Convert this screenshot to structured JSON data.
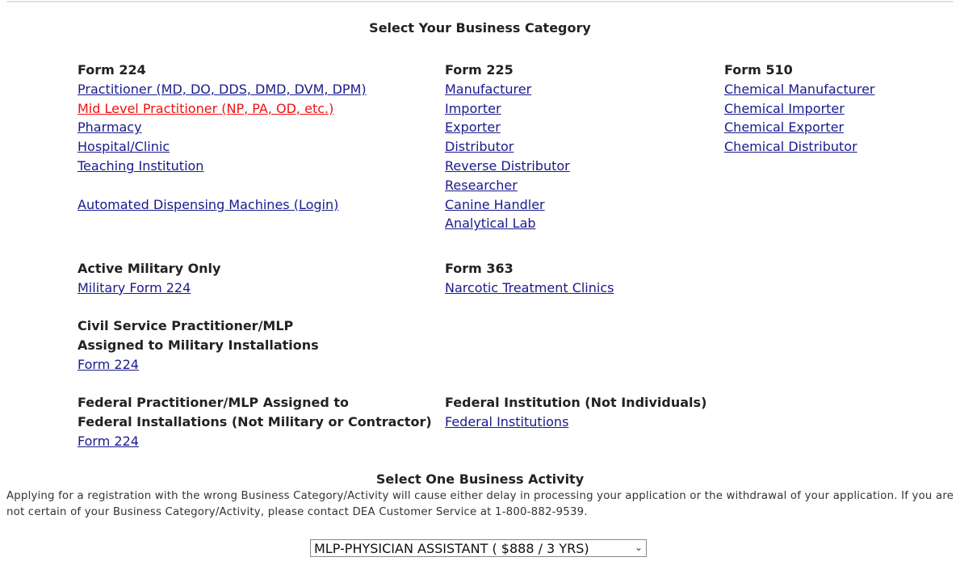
{
  "header": {
    "title": "Select Your Business Category"
  },
  "columns": {
    "form224": {
      "heading": "Form 224",
      "links": [
        {
          "label": "Practitioner (MD, DO, DDS, DMD, DVM, DPM)",
          "color": "#1a1a8c"
        },
        {
          "label": "Mid Level Practitioner (NP, PA, OD, etc.)",
          "color": "#ee1111",
          "selected": true
        },
        {
          "label": "Pharmacy"
        },
        {
          "label": "Hospital/Clinic"
        },
        {
          "label": "Teaching Institution"
        }
      ],
      "extra_link": "Automated Dispensing Machines (Login)"
    },
    "form225": {
      "heading": "Form 225",
      "links": [
        "Manufacturer",
        "Importer",
        "Exporter",
        "Distributor",
        "Reverse Distributor",
        "Researcher",
        "Canine Handler",
        "Analytical Lab"
      ]
    },
    "form510": {
      "heading": "Form 510",
      "links": [
        "Chemical Manufacturer",
        "Chemical Importer",
        "Chemical Exporter",
        "Chemical Distributor"
      ]
    },
    "military": {
      "heading": "Active Military Only",
      "link": "Military Form 224"
    },
    "form363": {
      "heading": "Form 363",
      "link": "Narcotic Treatment Clinics"
    },
    "civil": {
      "heading_line1": "Civil Service Practitioner/MLP",
      "heading_line2": "Assigned to Military Installations",
      "link": "Form 224"
    },
    "federal_practitioner": {
      "heading_line1": "Federal Practitioner/MLP Assigned to",
      "heading_line2": "Federal Installations (Not Military or Contractor)",
      "link": "Form 224"
    },
    "federal_institution": {
      "heading": "Federal Institution (Not Individuals)",
      "link": "Federal Institutions"
    }
  },
  "activity": {
    "title": "Select One Business Activity",
    "notice": "Applying for a registration with the wrong Business Category/Activity will cause either delay in processing your application or the withdrawal of your application. If you are not certain of your Business Category/Activity, please contact DEA Customer Service at 1-800-882-9539.",
    "selected_option": "MLP-PHYSICIAN ASSISTANT ( $888 / 3 YRS)"
  },
  "colors": {
    "link": "#1a1a8c",
    "active_link": "#ee1111"
  }
}
